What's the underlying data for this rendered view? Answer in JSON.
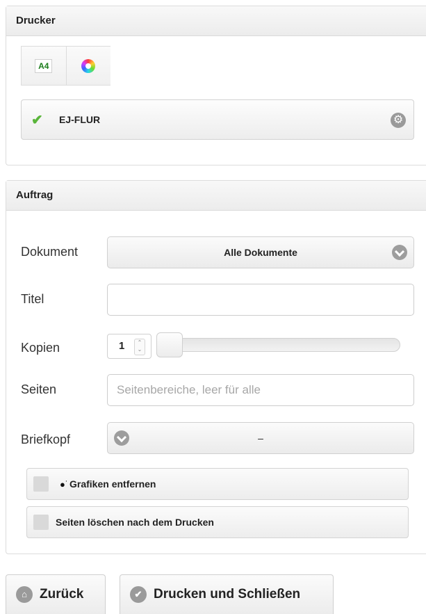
{
  "printer_panel": {
    "title": "Drucker",
    "chips": {
      "format_label": "A4"
    },
    "printer_name": "EJ-FLUR"
  },
  "job_panel": {
    "title": "Auftrag",
    "document": {
      "label": "Dokument",
      "value": "Alle Dokumente"
    },
    "title_field": {
      "label": "Titel",
      "value": ""
    },
    "copies": {
      "label": "Kopien",
      "value": "1",
      "slider_fraction": 0.0
    },
    "pages": {
      "label": "Seiten",
      "placeholder": "Seitenbereiche, leer für alle",
      "value": ""
    },
    "letterhead": {
      "label": "Briefkopf",
      "value": "–"
    },
    "options": [
      {
        "label": "Grafiken entfernen",
        "checked": false,
        "icon": "ink-drops-icon"
      },
      {
        "label": "Seiten löschen nach dem Drucken",
        "checked": false
      }
    ]
  },
  "buttons": {
    "back": "Zurück",
    "print_close": "Drucken und Schließen"
  },
  "colors": {
    "accent_green": "#59b53a",
    "icon_gray": "#9a9a9a",
    "panel_header_bg": "#ececec"
  }
}
